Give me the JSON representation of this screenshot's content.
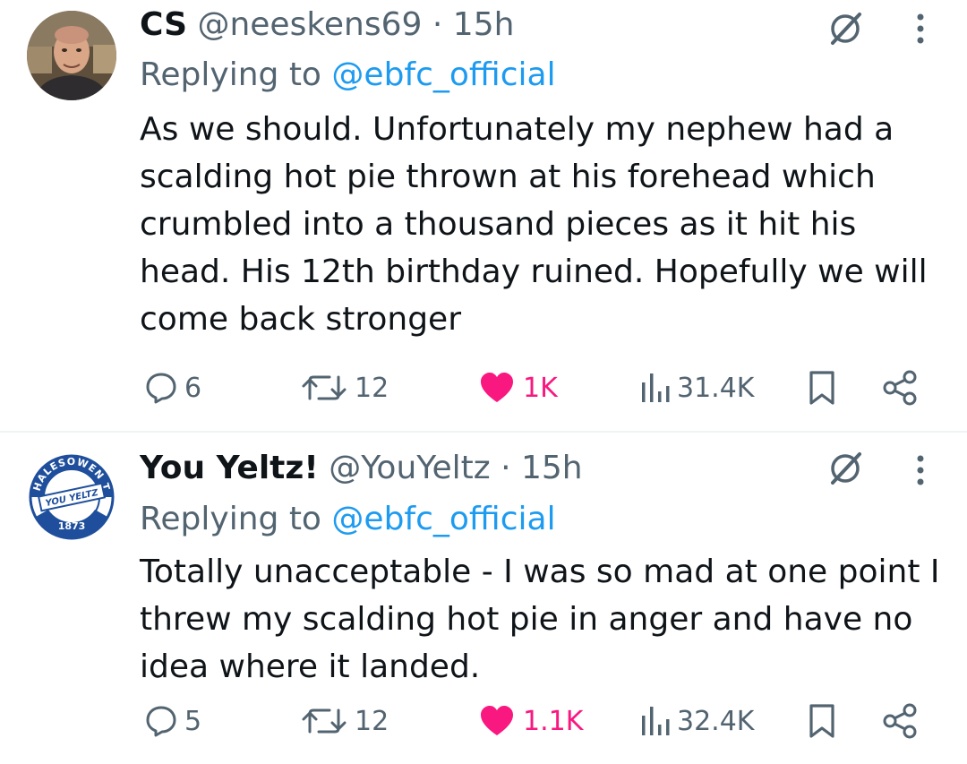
{
  "tweets": [
    {
      "avatar_icon": "person-photo-avatar",
      "name": "CS",
      "handle": "@neeskens69",
      "separator": "·",
      "time": "15h",
      "replying_prefix": "Replying to",
      "replying_to": "@ebfc_official",
      "text": "As we should. Unfortunately my nephew had a scalding hot pie thrown at his forehead which crumbled into a thousand pieces as it hit his head. His 12th birthday ruined. Hopefully we will come back stronger",
      "actions": {
        "replies": "6",
        "reposts": "12",
        "likes": "1K",
        "views": "31.4K"
      }
    },
    {
      "avatar_icon": "halesowen-club-crest-avatar",
      "avatar_crest_text": "HALESOWEN T",
      "avatar_crest_banner": "YOU YELTZ",
      "avatar_crest_year": "1873",
      "name": "You Yeltz!",
      "handle": "@YouYeltz",
      "separator": "·",
      "time": "15h",
      "replying_prefix": "Replying to",
      "replying_to": "@ebfc_official",
      "text": "Totally unacceptable - I was so mad at one point I threw my scalding hot pie in anger and have no idea where it landed.",
      "actions": {
        "replies": "5",
        "reposts": "12",
        "likes": "1.1K",
        "views": "32.4K"
      }
    }
  ],
  "colors": {
    "text_primary": "#0f1419",
    "text_secondary": "#536471",
    "link": "#1d9bf0",
    "like": "#f91880",
    "divider": "#eff3f4",
    "crest_blue": "#1f4f9c"
  },
  "icons": {
    "grok": "grok-icon",
    "more": "more-dots-icon",
    "reply": "reply-bubble-icon",
    "repost": "repost-arrows-icon",
    "like": "heart-filled-icon",
    "views": "views-bar-chart-icon",
    "bookmark": "bookmark-icon",
    "share": "share-icon"
  }
}
